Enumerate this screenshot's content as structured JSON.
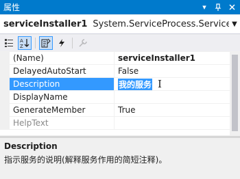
{
  "window": {
    "title": "属性",
    "buttons": {
      "dropdown": "▾",
      "pin": "📌",
      "close": "✕"
    }
  },
  "object_selector": {
    "name": "serviceInstaller1",
    "type": "System.ServiceProcess.ServiceInstaller"
  },
  "toolbar": {
    "tools": [
      "categorized",
      "alphabetical",
      "properties",
      "events",
      "property-pages"
    ]
  },
  "grid": {
    "rows": [
      {
        "name": "(Name)",
        "value": "serviceInstaller1"
      },
      {
        "name": "DelayedAutoStart",
        "value": "False"
      },
      {
        "name": "Description",
        "value": "我的服务"
      },
      {
        "name": "DisplayName",
        "value": ""
      },
      {
        "name": "GenerateMember",
        "value": "True"
      },
      {
        "name": "HelpText",
        "value": ""
      }
    ]
  },
  "description_pane": {
    "title": "Description",
    "text": "指示服务的说明(解释服务作用的简短注释)。"
  },
  "colors": {
    "accent": "#007acc",
    "selection": "#3399ff"
  }
}
